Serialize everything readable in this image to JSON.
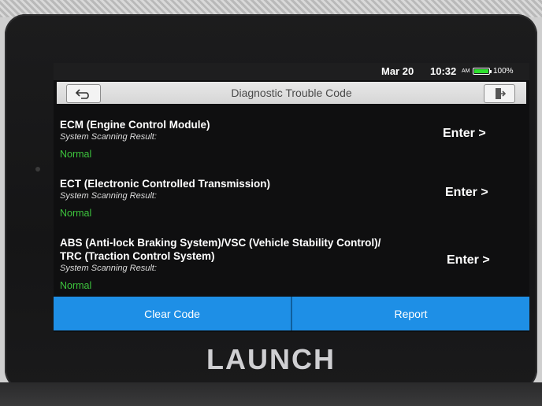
{
  "status": {
    "date": "Mar 20",
    "time": "10:32",
    "ampm": "AM",
    "battery": "100%"
  },
  "header": {
    "title": "Diagnostic Trouble Code",
    "back_icon": "back-arrow-icon",
    "exit_icon": "exit-door-icon"
  },
  "systems": [
    {
      "name_line1": "ECM (Engine Control Module)",
      "name_line2": "",
      "subtitle": "System Scanning Result:",
      "result": "Normal",
      "enter": "Enter >"
    },
    {
      "name_line1": "ECT (Electronic Controlled Transmission)",
      "name_line2": "",
      "subtitle": "System Scanning Result:",
      "result": "Normal",
      "enter": "Enter >"
    },
    {
      "name_line1": "ABS (Anti-lock Braking System)/VSC (Vehicle Stability Control)/",
      "name_line2": "TRC (Traction Control System)",
      "subtitle": "System Scanning Result:",
      "result": "Normal",
      "enter": "Enter >"
    }
  ],
  "actions": {
    "clear_code": "Clear Code",
    "report": "Report"
  },
  "brand": {
    "logo_text": "LAUNCH"
  },
  "colors": {
    "accent": "#1e8fe6",
    "normal_status": "#3dc43d",
    "screen_bg": "#0f0f10"
  }
}
